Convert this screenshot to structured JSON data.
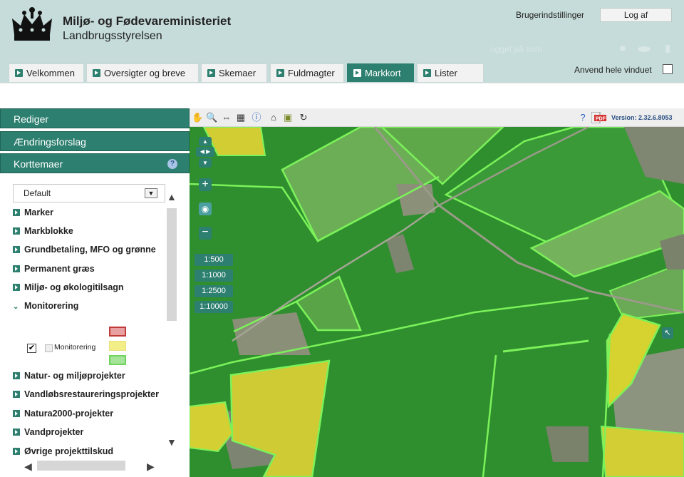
{
  "header": {
    "org_name": "Miljø- og Fødevareministeriet",
    "agency_name": "Landbrugsstyrelsen",
    "user_settings": "Brugerindstillinger",
    "logout": "Log af",
    "ghost_text": "ogget på som",
    "use_window": "Anvend hele vinduet",
    "use_window_checked": false
  },
  "tabs": [
    {
      "label": "Velkommen",
      "active": false
    },
    {
      "label": "Oversigter og breve",
      "active": false
    },
    {
      "label": "Skemaer",
      "active": false
    },
    {
      "label": "Fuldmagter",
      "active": false
    },
    {
      "label": "Markkort",
      "active": true
    },
    {
      "label": "Lister",
      "active": false
    }
  ],
  "panel": {
    "sections": [
      "Rediger",
      "Ændringsforslag",
      "Korttemaer"
    ],
    "help_icon": "?",
    "select_value": "Default",
    "layers": [
      {
        "label": "Marker",
        "expanded": false
      },
      {
        "label": "Markblokke",
        "expanded": false
      },
      {
        "label": "Grundbetaling, MFO og grønne",
        "expanded": false
      },
      {
        "label": "Permanent græs",
        "expanded": false
      },
      {
        "label": "Miljø- og økologitilsagn",
        "expanded": false
      },
      {
        "label": "Monitorering",
        "expanded": true
      },
      {
        "label": "Natur- og miljøprojekter",
        "expanded": false
      },
      {
        "label": "Vandløbsrestaureringsprojekter",
        "expanded": false
      },
      {
        "label": "Natura2000-projekter",
        "expanded": false
      },
      {
        "label": "Vandprojekter",
        "expanded": false
      },
      {
        "label": "Øvrige projekttilskud",
        "expanded": false
      }
    ],
    "monitorering_sub": "Monitorering",
    "monitorering_checked": true,
    "legend_colors": [
      "#e8a0a0",
      "#f2ee88",
      "#a6e49a"
    ]
  },
  "toolbar": {
    "icons": [
      "pan-hand-icon",
      "zoom-icon",
      "measure-icon",
      "layers-icon",
      "info-icon",
      "home-icon",
      "map-icon",
      "refresh-icon"
    ],
    "version": "Version: 2.32.6.8053"
  },
  "map": {
    "scales": [
      "1:500",
      "1:1000",
      "1:2500",
      "1:10000"
    ]
  },
  "colors": {
    "accent": "#2d7f6f",
    "header_bg": "#c5dcda",
    "field_green": "#2e8e2c",
    "field_outline": "#7bf25a",
    "monitor_yellow": "#d4cf2e"
  }
}
